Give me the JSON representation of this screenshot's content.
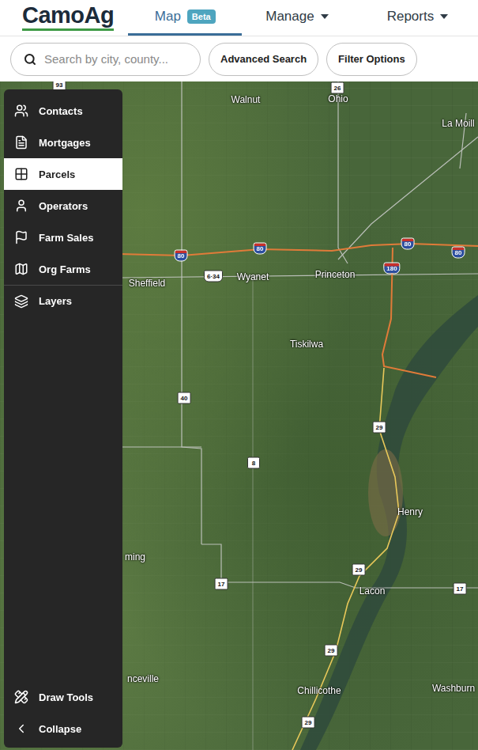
{
  "nav": {
    "logo": "CamoAg",
    "tabs": [
      {
        "label": "Map",
        "badge": "Beta",
        "selected": true,
        "dropdown": false
      },
      {
        "label": "Manage",
        "badge": "",
        "selected": false,
        "dropdown": true
      },
      {
        "label": "Reports",
        "badge": "",
        "selected": false,
        "dropdown": true
      }
    ]
  },
  "search": {
    "placeholder": "Search by city, county...",
    "buttons": [
      "Advanced Search",
      "Filter Options"
    ]
  },
  "sidebar": {
    "items": [
      {
        "label": "Contacts",
        "selected": false
      },
      {
        "label": "Mortgages",
        "selected": false
      },
      {
        "label": "Parcels",
        "selected": true
      },
      {
        "label": "Operators",
        "selected": false
      },
      {
        "label": "Farm Sales",
        "selected": false
      },
      {
        "label": "Org Farms",
        "selected": false
      },
      {
        "label": "Layers",
        "selected": false
      }
    ],
    "footer": [
      {
        "label": "Draw Tools"
      },
      {
        "label": "Collapse"
      }
    ]
  },
  "map": {
    "places": [
      {
        "name": "Walnut"
      },
      {
        "name": "Ohio"
      },
      {
        "name": "La Moill"
      },
      {
        "name": "Sheffield"
      },
      {
        "name": "Wyanet"
      },
      {
        "name": "Princeton"
      },
      {
        "name": "Tiskilwa"
      },
      {
        "name": "Henry"
      },
      {
        "name": "Lacon"
      },
      {
        "name": "Chillicothe"
      },
      {
        "name": "Washburn"
      },
      {
        "name": "ming"
      },
      {
        "name": "nceville"
      }
    ],
    "shields": [
      {
        "label": "93",
        "kind": "state"
      },
      {
        "label": "26",
        "kind": "state"
      },
      {
        "label": "80",
        "kind": "interstate"
      },
      {
        "label": "80",
        "kind": "interstate"
      },
      {
        "label": "80",
        "kind": "interstate"
      },
      {
        "label": "80",
        "kind": "interstate"
      },
      {
        "label": "180",
        "kind": "interstate"
      },
      {
        "label": "6·34",
        "kind": "us"
      },
      {
        "label": "40",
        "kind": "state"
      },
      {
        "label": "8",
        "kind": "state"
      },
      {
        "label": "29",
        "kind": "state"
      },
      {
        "label": "17",
        "kind": "state"
      },
      {
        "label": "29",
        "kind": "state"
      },
      {
        "label": "17",
        "kind": "state"
      },
      {
        "label": "29",
        "kind": "state"
      },
      {
        "label": "29",
        "kind": "state"
      }
    ]
  }
}
